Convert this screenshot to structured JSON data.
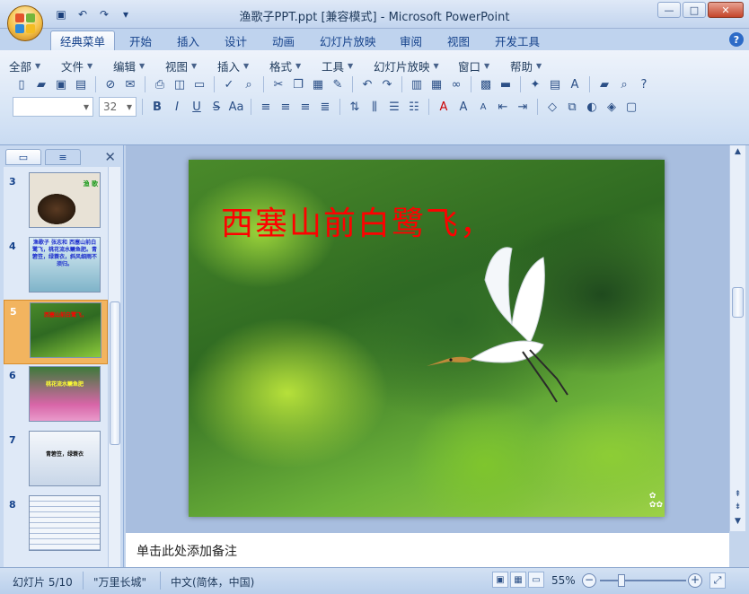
{
  "window": {
    "title": "渔歌子PPT.ppt [兼容模式] - Microsoft PowerPoint",
    "controls": {
      "minimize": "—",
      "maximize": "□",
      "close": "✕"
    }
  },
  "quick_access": [
    {
      "name": "save-icon",
      "glyph": "💾"
    },
    {
      "name": "undo-icon",
      "glyph": "↶"
    },
    {
      "name": "redo-icon",
      "glyph": "↷"
    },
    {
      "name": "customize-icon",
      "glyph": "▾"
    }
  ],
  "tabs": [
    "经典菜单",
    "开始",
    "插入",
    "设计",
    "动画",
    "幻灯片放映",
    "审阅",
    "视图",
    "开发工具"
  ],
  "active_tab": "经典菜单",
  "help_label": "?",
  "menubar": [
    "全部",
    "文件",
    "编辑",
    "视图",
    "插入",
    "格式",
    "工具",
    "幻灯片放映",
    "窗口",
    "帮助"
  ],
  "toolbar": {
    "font_name": "",
    "font_size": "32",
    "row1_icons": [
      "new-document-icon",
      "open-folder-icon",
      "save-icon",
      "pdf-icon",
      "permission-icon",
      "email-icon",
      "print-icon",
      "print-preview-icon",
      "layout-icon",
      "spelling-icon",
      "research-icon",
      "cut-icon",
      "copy-icon",
      "paste-icon",
      "format-painter-icon",
      "undo-icon",
      "redo-icon",
      "chart-icon",
      "table-icon",
      "hyperlink-icon",
      "picture-icon",
      "color-icon",
      "new-slide-icon",
      "slide-layout-icon",
      "textbox-icon",
      "open-icon",
      "zoom-icon",
      "help-icon"
    ],
    "row2_icons": [
      "bold-icon",
      "italic-icon",
      "underline-icon",
      "strikethrough-icon",
      "change-case-icon",
      "align-left-icon",
      "align-center-icon",
      "align-right-icon",
      "justify-icon",
      "text-direction-icon",
      "columns-icon",
      "bullets-icon",
      "numbering-icon",
      "font-color-icon",
      "grow-font-icon",
      "shrink-font-icon",
      "decrease-indent-icon",
      "increase-indent-icon",
      "shapes-icon",
      "arrange-icon",
      "quick-styles-icon",
      "fill-icon",
      "outline-icon"
    ]
  },
  "side_panel": {
    "tab_slides": "▭",
    "tab_outline": "≡",
    "close": "✕",
    "slides": [
      {
        "num": "3",
        "text": "渔 歌"
      },
      {
        "num": "4",
        "text": "渔歌子 张志和 西塞山前白鹭飞，桃花流水鳜鱼肥。青箬笠，绿蓑衣，斜风细雨不须归。"
      },
      {
        "num": "5",
        "text": "西塞山前白鹭飞，"
      },
      {
        "num": "6",
        "text": "桃花流水鳜鱼肥"
      },
      {
        "num": "7",
        "text": "青箬笠，绿蓑衣"
      },
      {
        "num": "8",
        "text": ""
      }
    ],
    "selected_slide": "5"
  },
  "slide": {
    "title_text": "西塞山前白鹭飞，",
    "title_color": "#ff0000"
  },
  "notes_placeholder": "单击此处添加备注",
  "status": {
    "slide_info": "幻灯片 5/10",
    "theme": "\"万里长城\"",
    "language": "中文(简体，中国)",
    "zoom": "55%",
    "zoom_level": 0.55
  },
  "colors": {
    "accent": "#15428b",
    "selected_thumb": "#f2b45f"
  }
}
